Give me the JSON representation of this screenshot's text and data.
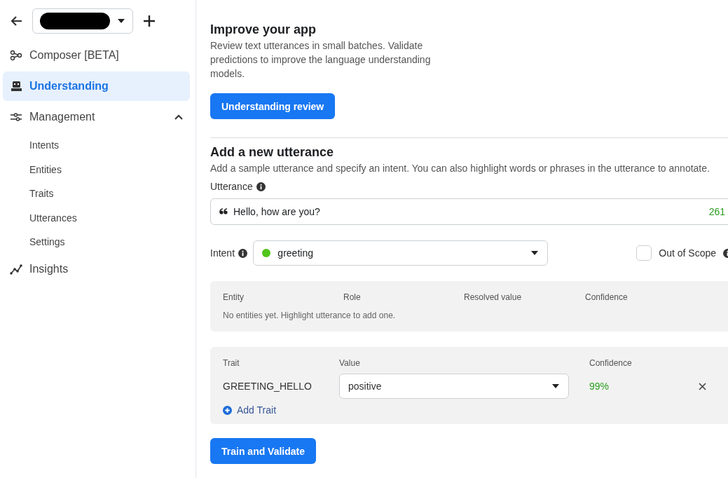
{
  "sidebar": {
    "items": [
      {
        "label": "Composer [BETA]",
        "selected": false
      },
      {
        "label": "Understanding",
        "selected": true
      },
      {
        "label": "Management",
        "selected": false,
        "expanded": true,
        "children": [
          {
            "label": "Intents"
          },
          {
            "label": "Entities"
          },
          {
            "label": "Traits"
          },
          {
            "label": "Utterances"
          },
          {
            "label": "Settings"
          }
        ]
      },
      {
        "label": "Insights",
        "selected": false
      }
    ]
  },
  "improve": {
    "title": "Improve your app",
    "description": "Review text utterances in small batches. Validate predictions to improve the language understanding models.",
    "button": "Understanding review"
  },
  "add_utterance": {
    "title": "Add a new utterance",
    "description": "Add a sample utterance and specify an intent. You can also highlight words or phrases in the utterance to annotate.",
    "utterance_label": "Utterance",
    "utterance": "Hello, how are you?",
    "char_count": "261",
    "intent_label": "Intent",
    "intent": {
      "name": "greeting",
      "color": "#52c41a"
    },
    "out_of_scope": {
      "label": "Out of Scope",
      "checked": false
    }
  },
  "entities": {
    "columns": [
      "Entity",
      "Role",
      "Resolved value",
      "Confidence"
    ],
    "empty": "No entities yet. Highlight utterance to add one."
  },
  "traits": {
    "columns": [
      "Trait",
      "Value",
      "Confidence"
    ],
    "rows": [
      {
        "trait": "GREETING_HELLO",
        "value": "positive",
        "confidence": "99%"
      }
    ],
    "add": "Add Trait"
  },
  "submit": "Train and Validate"
}
